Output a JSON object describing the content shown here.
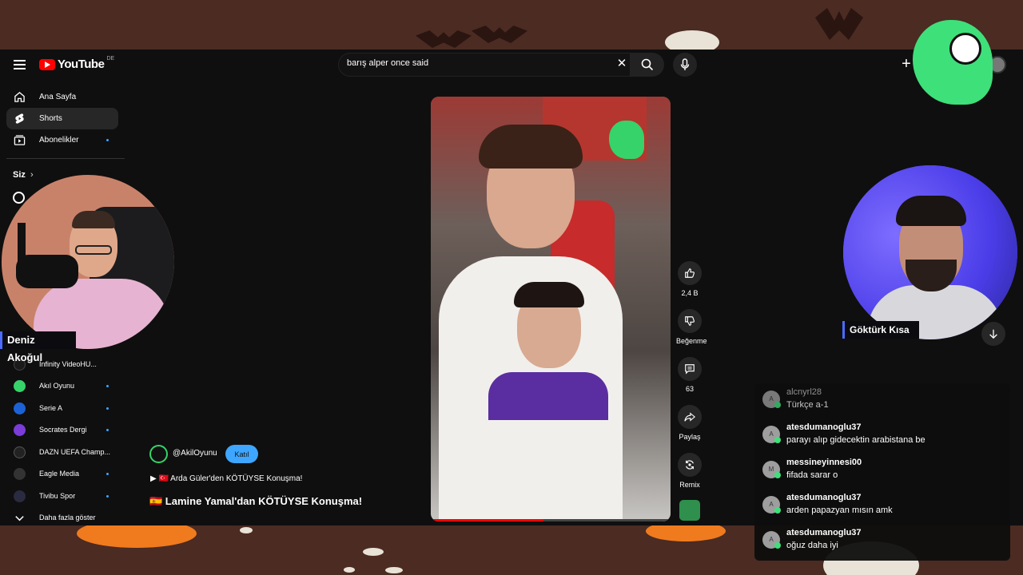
{
  "masthead": {
    "logo_text": "YouTube",
    "country_code": "DE",
    "search_value": "barış alper once said",
    "clear_glyph": "✕",
    "create_glyph": "+"
  },
  "sidebar": {
    "nav": [
      {
        "label": "Ana Sayfa",
        "icon": "home-icon"
      },
      {
        "label": "Shorts",
        "icon": "shorts-icon"
      },
      {
        "label": "Abonelikler",
        "icon": "subscriptions-icon"
      }
    ],
    "you_label": "Siz",
    "you_chevron": "›",
    "subscriptions": [
      {
        "label": "Infinity VideoHU...",
        "color": "#1a1a1a"
      },
      {
        "label": "Akıl Oyunu",
        "color": "#35d36a"
      },
      {
        "label": "Serie A",
        "color": "#1c62d6"
      },
      {
        "label": "Socrates Dergi",
        "color": "#7b3cd8"
      },
      {
        "label": "DAZN UEFA Champ...",
        "color": "#222222"
      },
      {
        "label": "Eagle Media",
        "color": "#333333"
      },
      {
        "label": "Tivibu Spor",
        "color": "#2a2a40"
      }
    ],
    "show_more": "Daha fazla göster"
  },
  "webcams": {
    "left_name": "Deniz Akoğul",
    "right_name": "Göktürk Kısa"
  },
  "short": {
    "channel": "@AkilOyunu",
    "join_label": "Katıl",
    "related_link": "▶ 🇹🇷 Arda Güler'den KÖTÜYSE Konuşma!",
    "title": "🇪🇸 Lamine Yamal'dan KÖTÜYSE Konuşma!",
    "progress": 0.47,
    "actions": {
      "like_count": "2,4 B",
      "dislike_label": "Beğenme",
      "comment_count": "63",
      "share_label": "Paylaş",
      "remix_label": "Remix"
    }
  },
  "chat": {
    "messages": [
      {
        "user": "alcnyrl28",
        "text": "Türkçe a-1",
        "initial": "A"
      },
      {
        "user": "atesdumanoglu37",
        "text": "parayı alıp gidecektin arabistana be",
        "initial": "A"
      },
      {
        "user": "messineyinnesi00",
        "text": "fifada sarar o",
        "initial": "M"
      },
      {
        "user": "atesdumanoglu37",
        "text": "arden papazyan mısın amk",
        "initial": "A"
      },
      {
        "user": "atesdumanoglu37",
        "text": "oğuz daha iyi",
        "initial": "A"
      }
    ]
  },
  "colors": {
    "accent_blue": "#3ea6ff",
    "youtube_red": "#ff0000",
    "brand_green": "#3ee07a",
    "frame_brown": "#4b2b22"
  }
}
